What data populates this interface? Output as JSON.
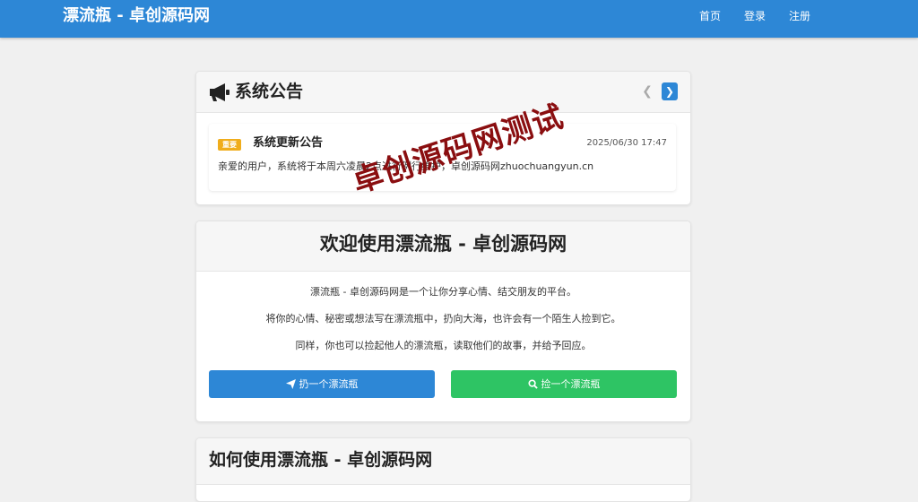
{
  "navbar": {
    "brand": "漂流瓶 - 卓创源码网",
    "links": [
      "首页",
      "登录",
      "注册"
    ]
  },
  "announcement": {
    "header_title": "系统公告",
    "prev_icon": "chevron-left-icon",
    "next_icon": "chevron-right-icon",
    "item": {
      "badge": "重要",
      "title": "系统更新公告",
      "date": "2025/06/30 17:47",
      "body": "亲爱的用户，系统将于本周六凌晨2点进行例行维护，卓创源码网zhuochuangyun.cn"
    }
  },
  "watermark": "卓创源码网测试",
  "welcome": {
    "title": "欢迎使用漂流瓶 - 卓创源码网",
    "paragraphs": [
      "漂流瓶 - 卓创源码网是一个让你分享心情、结交朋友的平台。",
      "将你的心情、秘密或想法写在漂流瓶中，扔向大海，也许会有一个陌生人捡到它。",
      "同样，你也可以捡起他人的漂流瓶，读取他们的故事，并给予回应。"
    ],
    "throw_button": "扔一个漂流瓶",
    "pick_button": "捡一个漂流瓶"
  },
  "howto": {
    "title": "如何使用漂流瓶 - 卓创源码网"
  },
  "colors": {
    "primary": "#2d87d6",
    "success": "#2ec464",
    "badge": "#f0ad1c",
    "watermark": "#8a0e10"
  }
}
